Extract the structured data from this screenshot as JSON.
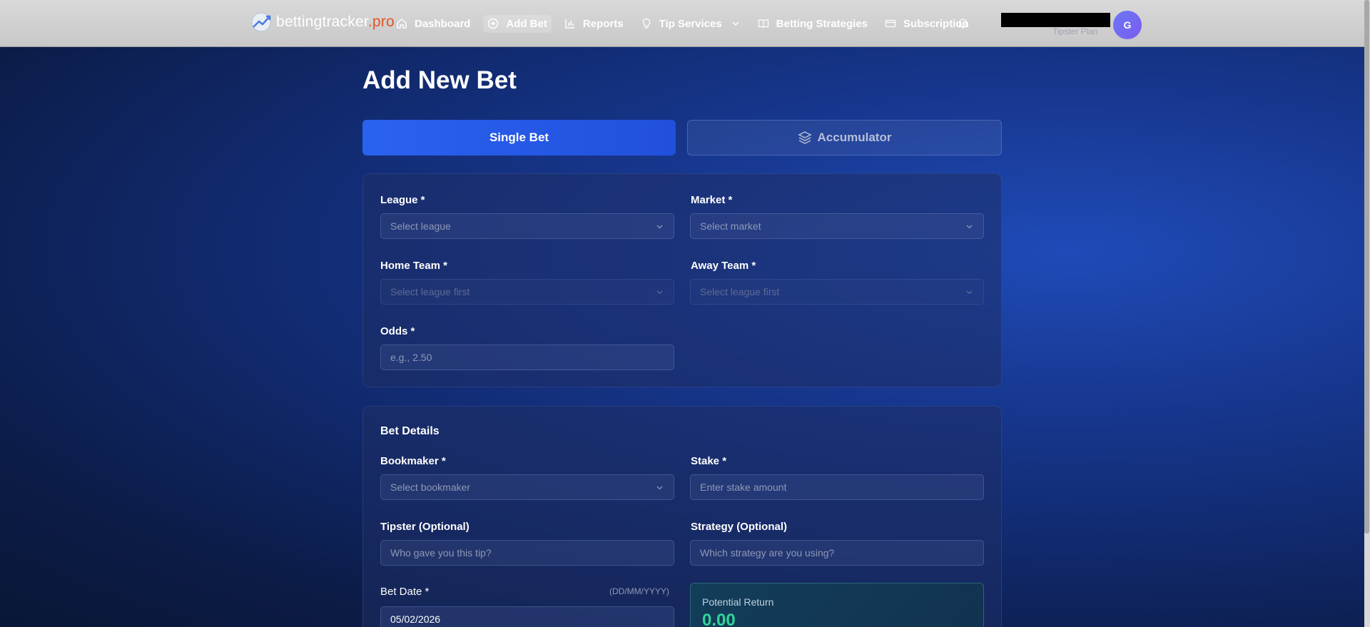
{
  "nav": {
    "logo_main": "bettingtracker",
    "logo_suffix": ".pro",
    "items": [
      {
        "label": "Dashboard",
        "icon": "home-icon"
      },
      {
        "label": "Add Bet",
        "icon": "plus-circle-icon",
        "active": true
      },
      {
        "label": "Reports",
        "icon": "bar-chart-icon"
      },
      {
        "label": "Tip Services",
        "icon": "lightbulb-icon"
      },
      {
        "label": "Betting Strategies",
        "icon": "book-open-icon"
      },
      {
        "label": "Subscription",
        "icon": "credit-card-icon"
      }
    ],
    "plan": "Tipster Plan",
    "avatar_initial": "G"
  },
  "page": {
    "title": "Add New Bet",
    "tabs": {
      "single": "Single Bet",
      "accumulator": "Accumulator"
    }
  },
  "match": {
    "league_label": "League *",
    "league_placeholder": "Select league",
    "market_label": "Market *",
    "market_placeholder": "Select market",
    "home_label": "Home Team *",
    "home_placeholder": "Select league first",
    "away_label": "Away Team *",
    "away_placeholder": "Select league first",
    "odds_label": "Odds *",
    "odds_placeholder": "e.g., 2.50"
  },
  "details": {
    "title": "Bet Details",
    "bookmaker_label": "Bookmaker *",
    "bookmaker_placeholder": "Select bookmaker",
    "stake_label": "Stake *",
    "stake_placeholder": "Enter stake amount",
    "tipster_label": "Tipster (Optional)",
    "tipster_placeholder": "Who gave you this tip?",
    "strategy_label": "Strategy (Optional)",
    "strategy_placeholder": "Which strategy are you using?",
    "date_label": "Bet Date *",
    "date_hint": "(DD/MM/YYYY)",
    "date_value": "05/02/2026",
    "return_label": "Potential Return",
    "return_value": "0.00"
  },
  "colors": {
    "accent": "#2a62f0",
    "success": "#34d399",
    "logo_pro": "#e2552a"
  }
}
